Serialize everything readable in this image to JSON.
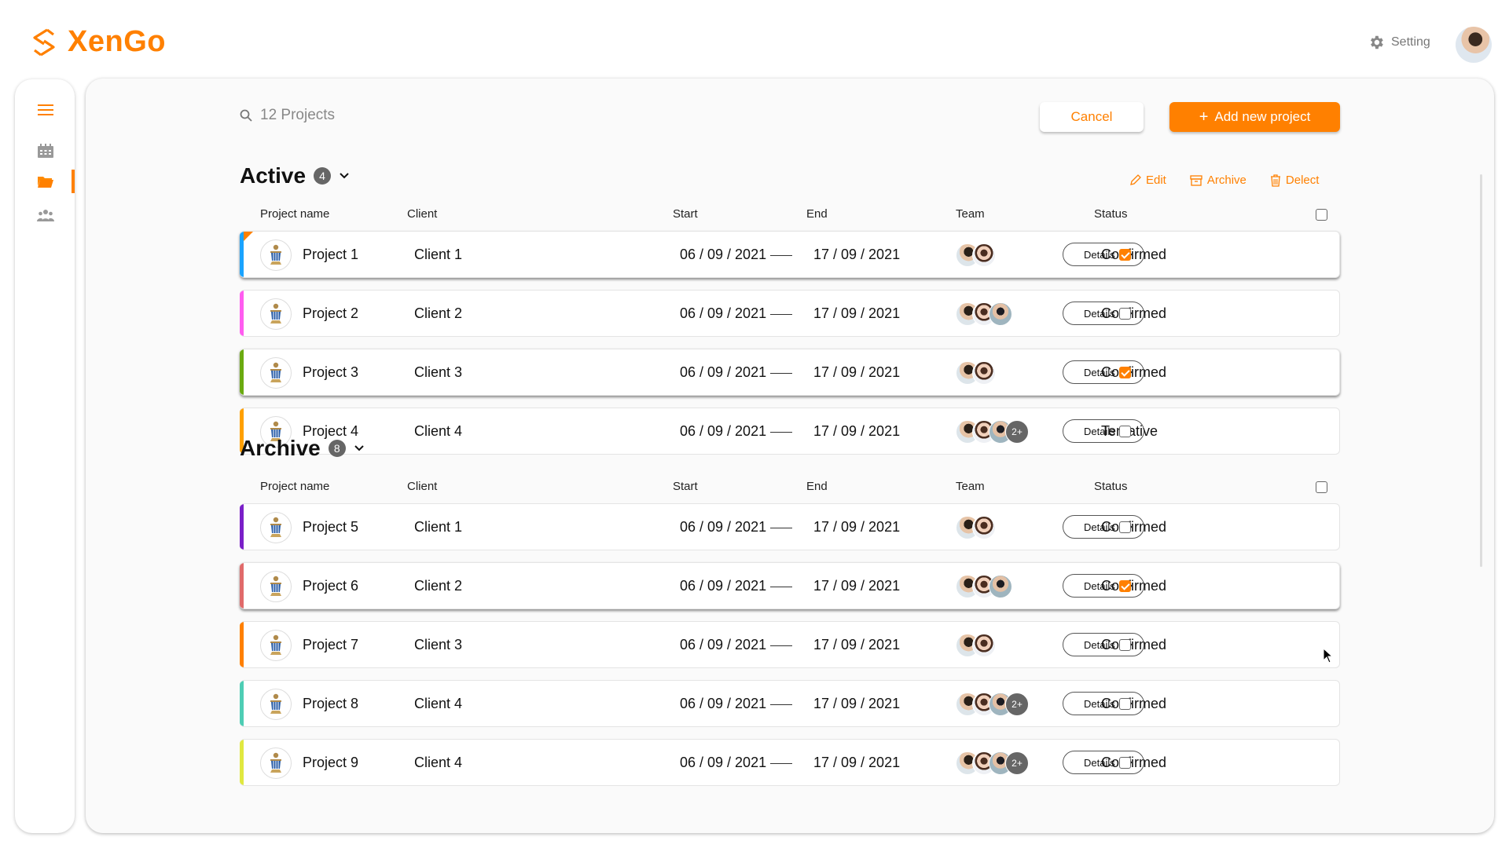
{
  "brand": {
    "name": "XenGo",
    "color": "#ff8000"
  },
  "header": {
    "setting_label": "Setting",
    "setting_icon": "gear-icon",
    "user_avatar": "user-avatar"
  },
  "sidebar": {
    "items": [
      {
        "icon": "menu-icon"
      },
      {
        "icon": "calendar-icon"
      },
      {
        "icon": "folder-icon",
        "active": true
      },
      {
        "icon": "team-icon"
      }
    ]
  },
  "toolbar": {
    "search_placeholder": "12 Projects",
    "cancel_label": "Cancel",
    "add_label": "Add new project",
    "add_icon": "+"
  },
  "bulk_actions": {
    "edit": "Edit",
    "archive": "Archive",
    "delete": "Delect"
  },
  "columns": {
    "name": "Project name",
    "client": "Client",
    "start": "Start",
    "end": "End",
    "team": "Team",
    "status": "Status"
  },
  "details_label": "Details",
  "sections": [
    {
      "title": "Active",
      "count": "4",
      "rows": [
        {
          "name": "Project 1",
          "client": "Client 1",
          "start": "06 / 09 / 2021",
          "end": "17 / 09 / 2021",
          "team": 2,
          "more": "",
          "status": "Confirmed",
          "checked": true,
          "color": "#1aa3ff"
        },
        {
          "name": "Project 2",
          "client": "Client 2",
          "start": "06 / 09 / 2021",
          "end": "17 / 09 / 2021",
          "team": 3,
          "more": "",
          "status": "Confirmed",
          "checked": false,
          "color": "#ff5cf0"
        },
        {
          "name": "Project 3",
          "client": "Client 3",
          "start": "06 / 09 / 2021",
          "end": "17 / 09 / 2021",
          "team": 2,
          "more": "",
          "status": "Confirmed",
          "checked": true,
          "color": "#6aaa10"
        },
        {
          "name": "Project 4",
          "client": "Client 4",
          "start": "06 / 09 / 2021",
          "end": "17 / 09 / 2021",
          "team": 3,
          "more": "2+",
          "status": "Tentative",
          "checked": false,
          "color": "#ffa000"
        }
      ]
    },
    {
      "title": "Archive",
      "count": "8",
      "rows": [
        {
          "name": "Project 5",
          "client": "Client 1",
          "start": "06 / 09 / 2021",
          "end": "17 / 09 / 2021",
          "team": 2,
          "more": "",
          "status": "Confirmed",
          "checked": false,
          "color": "#7a1fc8"
        },
        {
          "name": "Project 6",
          "client": "Client 2",
          "start": "06 / 09 / 2021",
          "end": "17 / 09 / 2021",
          "team": 3,
          "more": "",
          "status": "Confirmed",
          "checked": true,
          "color": "#e06a6a"
        },
        {
          "name": "Project 7",
          "client": "Client 3",
          "start": "06 / 09 / 2021",
          "end": "17 / 09 / 2021",
          "team": 2,
          "more": "",
          "status": "Confirmed",
          "checked": false,
          "color": "#ff8000"
        },
        {
          "name": "Project 8",
          "client": "Client 4",
          "start": "06 / 09 / 2021",
          "end": "17 / 09 / 2021",
          "team": 3,
          "more": "2+",
          "status": "Confirmed",
          "checked": false,
          "color": "#4ecdb4"
        },
        {
          "name": "Project 9",
          "client": "Client 4",
          "start": "06 / 09 / 2021",
          "end": "17 / 09 / 2021",
          "team": 3,
          "more": "2+",
          "status": "Confirmed",
          "checked": false,
          "color": "#e0e840"
        }
      ]
    }
  ]
}
